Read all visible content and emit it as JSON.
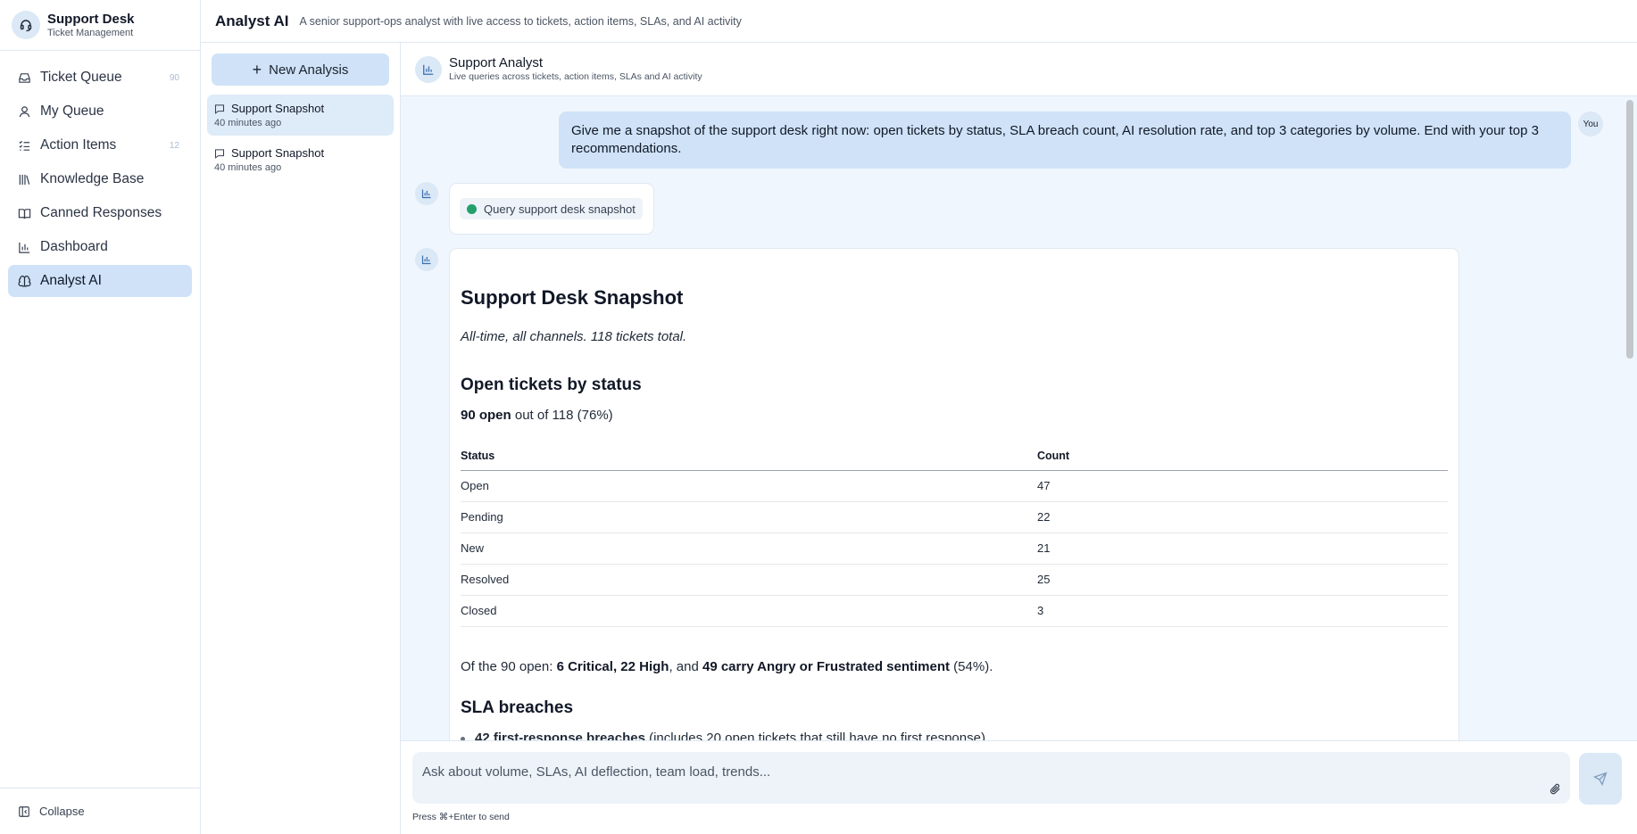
{
  "brand": {
    "name": "Support Desk",
    "subtitle": "Ticket Management"
  },
  "nav": [
    {
      "label": "Ticket Queue",
      "badge": "90",
      "icon": "inbox-icon"
    },
    {
      "label": "My Queue",
      "badge": "",
      "icon": "user-icon"
    },
    {
      "label": "Action Items",
      "badge": "12",
      "icon": "checklist-icon"
    },
    {
      "label": "Knowledge Base",
      "badge": "",
      "icon": "library-icon"
    },
    {
      "label": "Canned Responses",
      "badge": "",
      "icon": "book-icon"
    },
    {
      "label": "Dashboard",
      "badge": "",
      "icon": "bar-chart-icon"
    },
    {
      "label": "Analyst AI",
      "badge": "",
      "icon": "brain-icon",
      "active": true
    }
  ],
  "collapse_label": "Collapse",
  "topbar": {
    "title": "Analyst AI",
    "description": "A senior support-ops analyst with live access to tickets, action items, SLAs, and AI activity"
  },
  "history": {
    "new_label": "New Analysis",
    "items": [
      {
        "title": "Support Snapshot",
        "time": "40 minutes ago"
      },
      {
        "title": "Support Snapshot",
        "time": "40 minutes ago"
      }
    ]
  },
  "chat": {
    "title": "Support Analyst",
    "subtitle": "Live queries across tickets, action items, SLAs and AI activity",
    "user_badge": "You",
    "user_message": "Give me a snapshot of the support desk right now: open tickets by status, SLA breach count, AI resolution rate, and top 3 categories by volume. End with your top 3 recommendations.",
    "tool_call": "Query support desk snapshot"
  },
  "answer": {
    "title": "Support Desk Snapshot",
    "scope": "All-time, all channels. 118 tickets total.",
    "section_status": "Open tickets by status",
    "open_bold": "90 open",
    "open_rest": " out of 118 (76%)",
    "table_headers": [
      "Status",
      "Count"
    ],
    "table_rows": [
      [
        "Open",
        "47"
      ],
      [
        "Pending",
        "22"
      ],
      [
        "New",
        "21"
      ],
      [
        "Resolved",
        "25"
      ],
      [
        "Closed",
        "3"
      ]
    ],
    "summary_prefix": "Of the 90 open: ",
    "summary_b1": "6 Critical, 22 High",
    "summary_mid": ", and ",
    "summary_b2": "49 carry Angry or Frustrated sentiment",
    "summary_suffix": " (54%).",
    "section_sla": "SLA breaches",
    "sla_b1": "42 first-response breaches",
    "sla_rest1": " (includes 20 open tickets that still have no first response)"
  },
  "composer": {
    "placeholder": "Ask about volume, SLAs, AI deflection, team load, trends...",
    "hint": "Press ⌘+Enter to send"
  },
  "colors": {
    "accent": "#cfe2f7",
    "chat_bg": "#f0f6fd",
    "success_dot": "#22a06b"
  }
}
